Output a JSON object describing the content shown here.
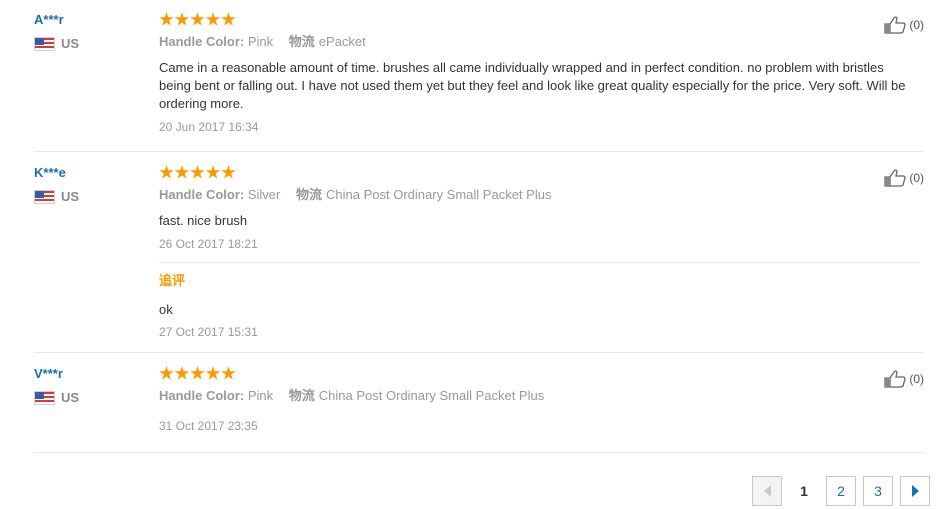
{
  "reviews": [
    {
      "user": "A***r",
      "country": "US",
      "rating": 5,
      "attr_label": "Handle Color:",
      "attr_value": "Pink",
      "shipping_label": "物流",
      "shipping_value": "ePacket",
      "text": "Came in a reasonable amount of time. brushes all came individually wrapped and in perfect condition. no problem with bristles being bent or falling out. I have not used them yet but they feel and look like great quality especially for the price. Very soft. Will be ordering more.",
      "date": "20 Jun 2017 16:34",
      "helpful": "(0)"
    },
    {
      "user": "K***e",
      "country": "US",
      "rating": 5,
      "attr_label": "Handle Color:",
      "attr_value": "Silver",
      "shipping_label": "物流",
      "shipping_value": "China Post Ordinary Small Packet Plus",
      "text": "fast. nice brush",
      "date": "26 Oct 2017 18:21",
      "helpful": "(0)",
      "followup": {
        "label": "追评",
        "text": "ok",
        "date": "27 Oct 2017 15:31"
      }
    },
    {
      "user": "V***r",
      "country": "US",
      "rating": 5,
      "attr_label": "Handle Color:",
      "attr_value": "Pink",
      "shipping_label": "物流",
      "shipping_value": "China Post Ordinary Small Packet Plus",
      "text": "",
      "date": "31 Oct 2017 23:35",
      "helpful": "(0)"
    }
  ],
  "pagination": {
    "current": "1",
    "pages": [
      "1",
      "2",
      "3"
    ],
    "prev_icon": "triangle-left-icon",
    "next_icon": "triangle-right-icon"
  },
  "colors": {
    "star": "#ff9900",
    "username": "#1a6db3",
    "followup_label": "#ff9900",
    "link": "#1a6db3"
  }
}
